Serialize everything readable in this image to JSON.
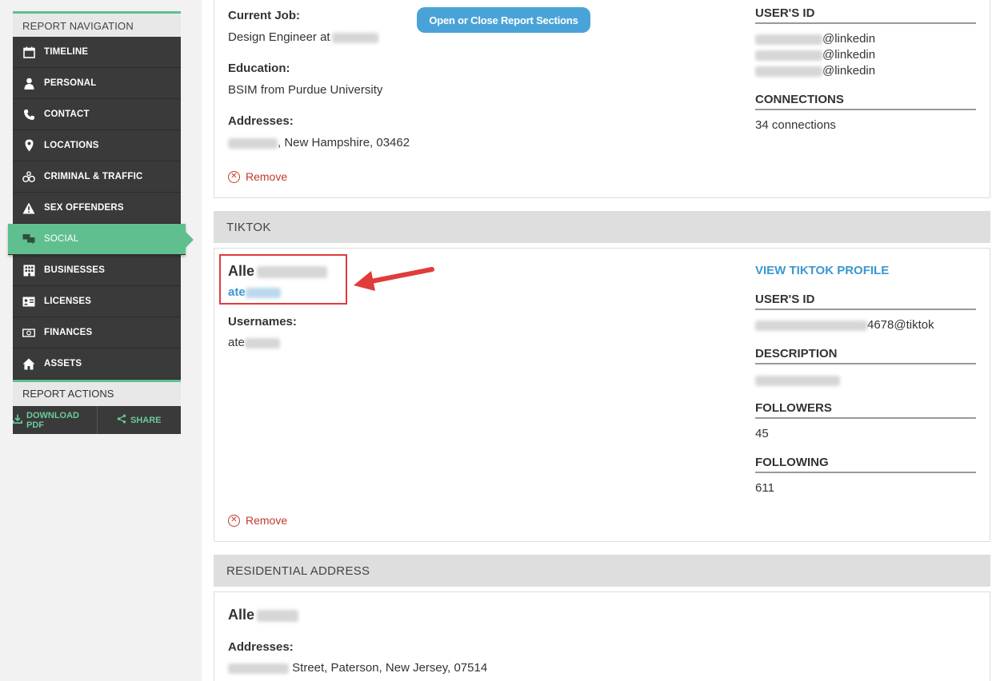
{
  "nav": {
    "header": "REPORT NAVIGATION",
    "items": [
      {
        "label": "TIMELINE",
        "icon": "calendar-icon"
      },
      {
        "label": "PERSONAL",
        "icon": "person-icon"
      },
      {
        "label": "CONTACT",
        "icon": "phone-icon"
      },
      {
        "label": "LOCATIONS",
        "icon": "map-pin-icon"
      },
      {
        "label": "CRIMINAL & TRAFFIC",
        "icon": "handcuffs-icon"
      },
      {
        "label": "SEX OFFENDERS",
        "icon": "warning-icon"
      },
      {
        "label": "SOCIAL",
        "icon": "chat-bubbles-icon",
        "active": true
      },
      {
        "label": "BUSINESSES",
        "icon": "building-icon"
      },
      {
        "label": "LICENSES",
        "icon": "id-card-icon"
      },
      {
        "label": "FINANCES",
        "icon": "money-icon"
      },
      {
        "label": "ASSETS",
        "icon": "house-icon"
      }
    ],
    "actions_header": "REPORT ACTIONS",
    "download_label": "DOWNLOAD PDF",
    "share_label": "SHARE"
  },
  "toggle_button": "Open or Close Report Sections",
  "linkedin": {
    "current_job_label": "Current Job:",
    "current_job_value": "Design Engineer at",
    "education_label": "Education:",
    "education_value": "BSIM from Purdue University",
    "addresses_label": "Addresses:",
    "address_value": ", New Hampshire, 03462",
    "remove_label": "Remove",
    "user_id_label": "USER'S ID",
    "user_ids": [
      "@linkedin",
      "@linkedin",
      "@linkedin"
    ],
    "connections_label": "CONNECTIONS",
    "connections_value": "34 connections"
  },
  "tiktok": {
    "section_title": "TIKTOK",
    "name": "Alle",
    "handle": "ate",
    "usernames_label": "Usernames:",
    "username_value": "ate",
    "view_profile": "VIEW TIKTOK PROFILE",
    "user_id_label": "USER'S ID",
    "user_id_value": "4678@tiktok",
    "description_label": "DESCRIPTION",
    "followers_label": "FOLLOWERS",
    "followers_value": "45",
    "following_label": "FOLLOWING",
    "following_value": "611",
    "remove_label": "Remove",
    "highlight_color": "#e03c3c"
  },
  "residential": {
    "section_title": "RESIDENTIAL ADDRESS",
    "name": "Alle",
    "addresses_label": "Addresses:",
    "address_value": " Street, Paterson, New Jersey, 07514"
  },
  "colors": {
    "accent_green": "#5fbf8f",
    "link_blue": "#3b97d3",
    "button_blue": "#4aa3d8",
    "remove_red": "#c0392b",
    "sidebar_dark": "#3a3a3a"
  }
}
